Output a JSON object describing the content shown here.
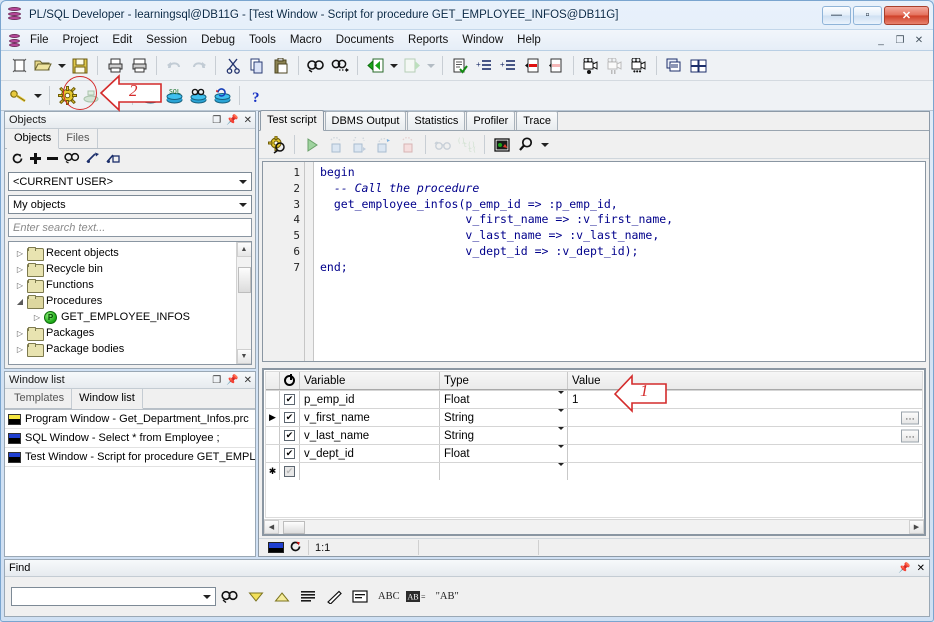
{
  "window": {
    "title": "PL/SQL Developer - learningsql@DB11G - [Test Window - Script for procedure GET_EMPLOYEE_INFOS@DB11G]",
    "app_icon": "database-icon",
    "buttons": {
      "minimize": "—",
      "maximize": "▫",
      "close": "✕"
    },
    "mdi_buttons": {
      "minimize": "_",
      "restore": "❐",
      "close": "✕"
    }
  },
  "menu": {
    "icon": "database-icon",
    "items": [
      "File",
      "Project",
      "Edit",
      "Session",
      "Debug",
      "Tools",
      "Macro",
      "Documents",
      "Reports",
      "Window",
      "Help"
    ]
  },
  "toolbar_main": {
    "items": [
      {
        "name": "new-window-icon",
        "label": "New"
      },
      {
        "name": "open-icon",
        "label": "Open"
      },
      {
        "name": "open-dropdown-caret",
        "label": "▼"
      },
      {
        "name": "save-icon",
        "label": "Save"
      },
      {
        "name": "print-icon",
        "label": "Print"
      },
      {
        "name": "print-preview-icon",
        "label": "Print Preview"
      },
      {
        "name": "undo-icon",
        "label": "Undo"
      },
      {
        "name": "redo-icon",
        "label": "Redo"
      },
      {
        "name": "cut-icon",
        "label": "Cut"
      },
      {
        "name": "copy-icon",
        "label": "Copy"
      },
      {
        "name": "paste-icon",
        "label": "Paste"
      },
      {
        "name": "find-icon",
        "label": "Find"
      },
      {
        "name": "find-next-icon",
        "label": "Find Next"
      },
      {
        "name": "previous-window-icon",
        "label": "Previous"
      },
      {
        "name": "previous-dropdown-caret",
        "label": "▼"
      },
      {
        "name": "next-window-icon",
        "label": "Next"
      },
      {
        "name": "next-dropdown-caret",
        "label": "▼"
      },
      {
        "name": "syntax-check-icon",
        "label": "Syntax Check"
      },
      {
        "name": "indent-icon",
        "label": "Indent"
      },
      {
        "name": "outdent-icon",
        "label": "Outdent"
      },
      {
        "name": "comment-icon",
        "label": "Comment"
      },
      {
        "name": "uncomment-icon",
        "label": "Uncomment"
      },
      {
        "name": "record-macro-icon",
        "label": "Record Macro"
      },
      {
        "name": "pause-macro-icon",
        "label": "Pause Macro"
      },
      {
        "name": "play-macro-icon",
        "label": "Play Macro"
      },
      {
        "name": "cascade-windows-icon",
        "label": "Cascade"
      },
      {
        "name": "tile-windows-icon",
        "label": "Tile"
      }
    ]
  },
  "toolbar_session": {
    "items": [
      {
        "name": "logon-key-icon",
        "label": "Log on"
      },
      {
        "name": "logon-dropdown-caret",
        "label": "▼"
      },
      {
        "name": "test-gear-icon",
        "label": "Test",
        "highlighted": true
      },
      {
        "name": "import-icon",
        "label": "Import"
      },
      {
        "name": "export-icon",
        "label": "Export"
      },
      {
        "name": "commit-icon",
        "label": "Commit"
      },
      {
        "name": "execute-sql-icon",
        "label": "Execute SQL"
      },
      {
        "name": "explain-plan-icon",
        "label": "Explain Plan"
      },
      {
        "name": "rollback-icon",
        "label": "Rollback"
      },
      {
        "name": "help-question-icon",
        "label": "?"
      }
    ]
  },
  "objects_panel": {
    "title": "Objects",
    "header_buttons": [
      "maximize-icon",
      "pin-icon",
      "close-icon"
    ],
    "tabs": [
      {
        "label": "Objects",
        "active": true
      },
      {
        "label": "Files",
        "active": false
      }
    ],
    "mini_toolbar": [
      {
        "name": "refresh-icon",
        "label": "↻"
      },
      {
        "name": "expand-all-icon",
        "label": "+"
      },
      {
        "name": "collapse-all-icon",
        "label": "−"
      },
      {
        "name": "find-object-icon",
        "label": "Find"
      },
      {
        "name": "filter-icon",
        "label": "Filter"
      },
      {
        "name": "lock-filter-icon",
        "label": "Lock"
      }
    ],
    "user_select": "<CURRENT USER>",
    "scope_select": "My objects",
    "search_placeholder": "Enter search text...",
    "tree": [
      {
        "label": "Recent objects",
        "icon": "folder-icon",
        "expanded": false,
        "level": 0
      },
      {
        "label": "Recycle bin",
        "icon": "folder-icon",
        "expanded": false,
        "level": 0
      },
      {
        "label": "Functions",
        "icon": "folder-icon",
        "expanded": false,
        "level": 0
      },
      {
        "label": "Procedures",
        "icon": "folder-open-icon",
        "expanded": true,
        "level": 0
      },
      {
        "label": "GET_EMPLOYEE_INFOS",
        "icon": "procedure-icon",
        "expanded": false,
        "level": 1
      },
      {
        "label": "Packages",
        "icon": "folder-icon",
        "expanded": false,
        "level": 0
      },
      {
        "label": "Package bodies",
        "icon": "folder-icon",
        "expanded": false,
        "level": 0
      }
    ]
  },
  "window_list_panel": {
    "title": "Window list",
    "header_buttons": [
      "maximize-icon",
      "pin-icon",
      "close-icon"
    ],
    "tabs": [
      {
        "label": "Templates",
        "active": false
      },
      {
        "label": "Window list",
        "active": true
      }
    ],
    "items": [
      {
        "label": "Program Window - Get_Department_Infos.prc",
        "color": "#f5e642"
      },
      {
        "label": "SQL Window - Select * from Employee ;",
        "color": "#1f3fd0"
      },
      {
        "label": "Test Window - Script for procedure GET_EMPLI",
        "color": "#1f3fd0"
      }
    ]
  },
  "test_window": {
    "tabs": [
      {
        "label": "Test script",
        "active": true
      },
      {
        "label": "DBMS Output",
        "active": false
      },
      {
        "label": "Statistics",
        "active": false
      },
      {
        "label": "Profiler",
        "active": false
      },
      {
        "label": "Trace",
        "active": false
      }
    ],
    "toolbar": [
      {
        "name": "start-debugger-icon",
        "label": "Start Debugger"
      },
      {
        "name": "run-icon",
        "label": "Run"
      },
      {
        "name": "step-into-icon",
        "label": "Step Into"
      },
      {
        "name": "step-over-icon",
        "label": "Step Over"
      },
      {
        "name": "step-out-icon",
        "label": "Step Out"
      },
      {
        "name": "run-to-exception-icon",
        "label": "Run to Exception"
      },
      {
        "name": "breakpoints-icon",
        "label": "Breakpoints"
      },
      {
        "name": "variables-icon",
        "label": "Variables"
      },
      {
        "name": "call-stack-icon",
        "label": "Call Stack"
      },
      {
        "name": "view-object-icon",
        "label": "View Object"
      },
      {
        "name": "zoom-icon",
        "label": "Zoom"
      },
      {
        "name": "zoom-dropdown-caret",
        "label": "▼"
      }
    ],
    "code_lines": [
      {
        "n": "1",
        "text": "begin",
        "comment": false
      },
      {
        "n": "2",
        "text": "  -- Call the procedure",
        "comment": true
      },
      {
        "n": "3",
        "text": "  get_employee_infos(p_emp_id => :p_emp_id,",
        "comment": false
      },
      {
        "n": "4",
        "text": "                     v_first_name => :v_first_name,",
        "comment": false
      },
      {
        "n": "5",
        "text": "                     v_last_name => :v_last_name,",
        "comment": false
      },
      {
        "n": "6",
        "text": "                     v_dept_id => :v_dept_id);",
        "comment": false
      },
      {
        "n": "7",
        "text": "end;",
        "comment": false
      }
    ],
    "variables_grid": {
      "columns": [
        "",
        "",
        "Variable",
        "Type",
        "Value"
      ],
      "rows": [
        {
          "indicator": "",
          "checked": true,
          "variable": "p_emp_id",
          "type": "Float",
          "value": "1",
          "has_ellipsis": false
        },
        {
          "indicator": "▶",
          "checked": true,
          "variable": "v_first_name",
          "type": "String",
          "value": "",
          "has_ellipsis": true
        },
        {
          "indicator": "",
          "checked": true,
          "variable": "v_last_name",
          "type": "String",
          "value": "",
          "has_ellipsis": true
        },
        {
          "indicator": "",
          "checked": true,
          "variable": "v_dept_id",
          "type": "Float",
          "value": "",
          "has_ellipsis": false
        },
        {
          "indicator": "✱",
          "checked": false,
          "variable": "",
          "type": "",
          "value": "",
          "has_ellipsis": false
        }
      ]
    },
    "status": {
      "position": "1:1",
      "connection_icon": "connection-flag-icon",
      "refresh_icon": "reconnect-icon"
    }
  },
  "find_bar": {
    "title": "Find",
    "header_buttons": [
      "pin-icon",
      "close-icon"
    ],
    "input_value": "",
    "buttons": [
      {
        "name": "find-icon",
        "label": "Find"
      },
      {
        "name": "find-next-down-icon",
        "label": "▼"
      },
      {
        "name": "find-previous-up-icon",
        "label": "▲"
      },
      {
        "name": "highlight-all-icon",
        "label": "Highlight All"
      },
      {
        "name": "clear-highlight-icon",
        "label": "Clear"
      },
      {
        "name": "find-in-selection-icon",
        "label": "In Selection"
      },
      {
        "name": "match-case-icon",
        "label": "ABC"
      },
      {
        "name": "regex-icon",
        "label": "AB="
      },
      {
        "name": "whole-word-icon",
        "label": "\"AB\""
      }
    ]
  },
  "annotations": [
    {
      "id": "1",
      "label": "1",
      "target": "value-cell-p-emp-id"
    },
    {
      "id": "2",
      "label": "2",
      "target": "test-gear-icon"
    }
  ],
  "colors": {
    "accent": "#d42b2b",
    "code": "#00008b",
    "comment": "#d01010",
    "chrome": "#f0f0f0"
  }
}
